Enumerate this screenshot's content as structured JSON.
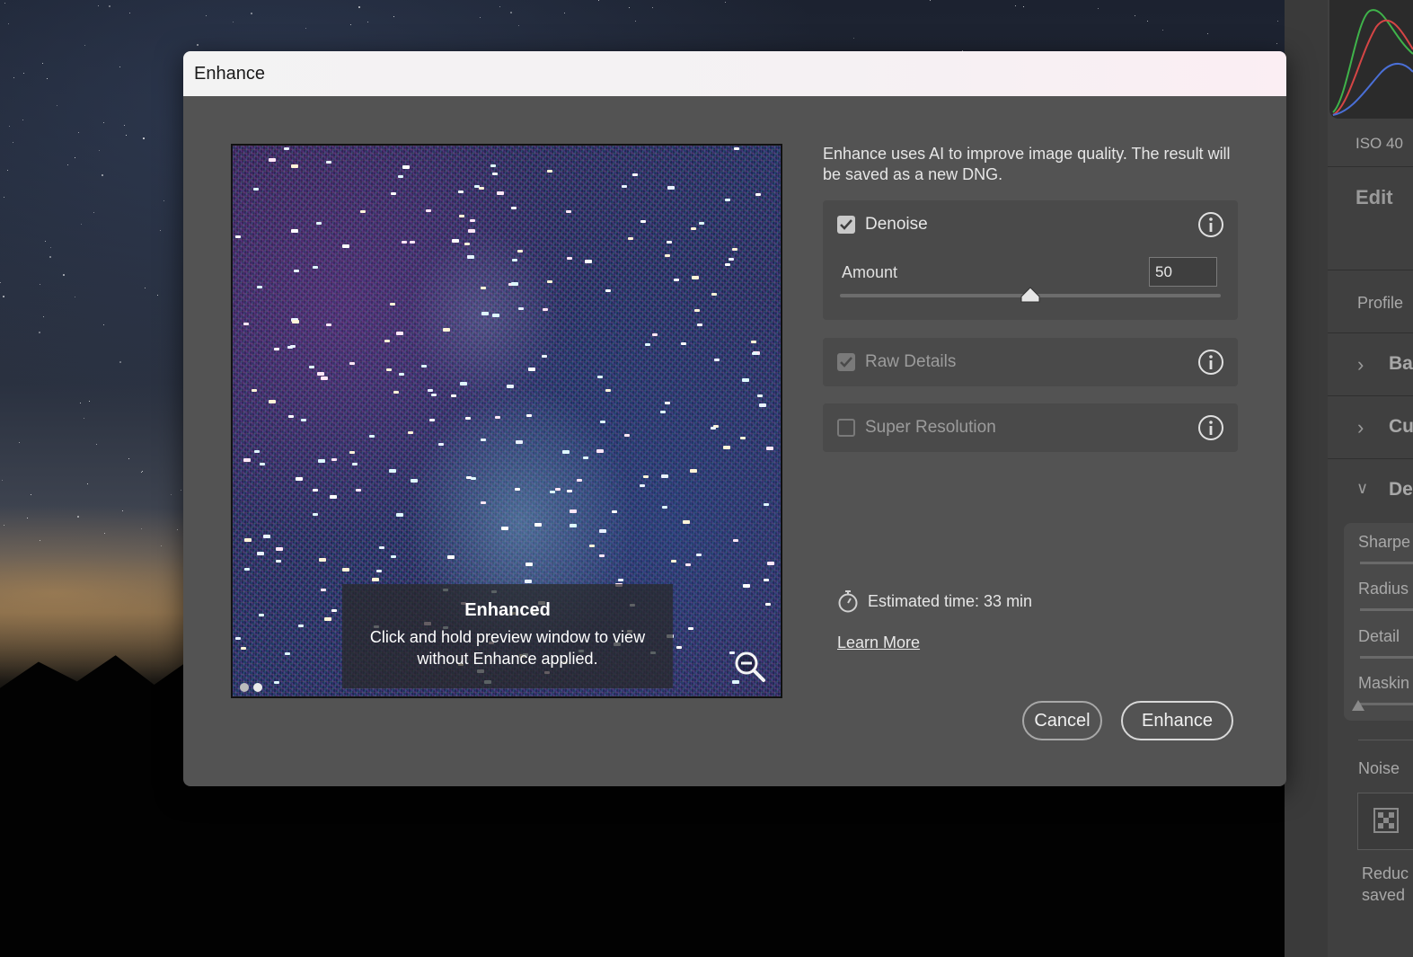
{
  "dialog": {
    "title": "Enhance",
    "intro": "Enhance uses AI to improve image quality. The result will be saved as a new DNG.",
    "preview": {
      "overlay_title": "Enhanced",
      "overlay_desc": "Click and hold preview window to view without Enhance applied.",
      "zoom_icon": "zoom-out-icon",
      "page_dots": 2,
      "active_dot": 2
    },
    "options": [
      {
        "label": "Denoise",
        "checked": true,
        "enabled": true,
        "info_icon": "info-icon"
      },
      {
        "label": "Raw Details",
        "checked": true,
        "enabled": false,
        "info_icon": "info-icon"
      },
      {
        "label": "Super Resolution",
        "checked": false,
        "enabled": true,
        "info_icon": "info-icon"
      }
    ],
    "denoise": {
      "amount_label": "Amount",
      "amount_value": "50",
      "amount_min": 0,
      "amount_max": 100
    },
    "estimated_time": "Estimated time: 33 min",
    "learn_more": "Learn More",
    "buttons": {
      "cancel": "Cancel",
      "enhance": "Enhance"
    }
  },
  "side_panel": {
    "iso": "ISO 40",
    "edit": "Edit",
    "profile": "Profile",
    "sections": [
      {
        "label": "Ba",
        "expanded": false
      },
      {
        "label": "Cu",
        "expanded": false
      },
      {
        "label": "De",
        "expanded": true
      }
    ],
    "detail_rows": [
      "Sharpe",
      "Radius",
      "Detail",
      "Maskin"
    ],
    "noise": "Noise",
    "noise_desc_1": "Reduc",
    "noise_desc_2": "saved"
  },
  "colors": {
    "dialog_bg": "#535353",
    "option_bg": "#4a4a4a",
    "panel_bg": "#404040"
  }
}
